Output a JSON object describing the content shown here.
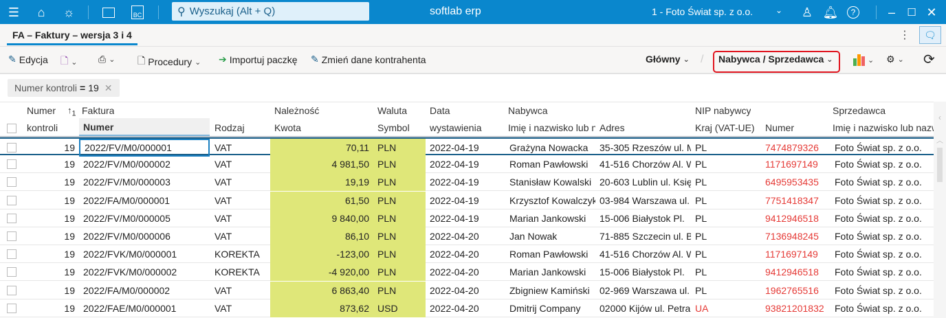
{
  "app": {
    "title": "softlab erp",
    "search_placeholder": "Wyszukaj (Alt + Q)",
    "company": "1 - Foto Świat sp. z o.o.",
    "icons": [
      "menu-icon",
      "home-icon",
      "bulb-icon",
      "news-icon",
      "bc-icon",
      "search-icon",
      "chevron-down-icon",
      "user-icon",
      "bell-icon",
      "help-icon",
      "minimize-icon",
      "maximize-icon",
      "close-icon"
    ]
  },
  "tab": {
    "label": "FA – Faktury – wersja 3 i 4"
  },
  "toolbar": {
    "edit": "Edycja",
    "procedures": "Procedury",
    "import": "Importuj paczkę",
    "change": "Zmień dane kontrahenta",
    "view_main": "Główny",
    "view_selected": "Nabywca / Sprzedawca"
  },
  "filter": {
    "label": "Numer kontroli",
    "op": "=",
    "value": "19"
  },
  "colors": {
    "accent": "#0a87cd",
    "highlight": "#dfe779",
    "nip": "#e53935"
  },
  "grid": {
    "groups": {
      "numer": "Numer",
      "faktura": "Faktura",
      "naleznosc": "Należność",
      "waluta": "Waluta",
      "data": "Data",
      "nabywca": "Nabywca",
      "nip": "NIP nabywcy",
      "sprzedawca": "Sprzedawca",
      "sort_order": "1"
    },
    "headers": {
      "kontroli": "kontroli",
      "numer": "Numer",
      "rodzaj": "Rodzaj",
      "kwota": "Kwota",
      "symbol": "Symbol",
      "wystawienia": "wystawienia",
      "imie": "Imię i nazwisko lub nazwa",
      "adres": "Adres",
      "kraj": "Kraj (VAT-UE)",
      "nip_numer": "Numer",
      "s_imie": "Imię i nazwisko lub nazwa"
    },
    "rows": [
      {
        "k": "19",
        "numer": "2022/FV/M0/000001",
        "rodzaj": "VAT",
        "kwota": "70,11",
        "sym": "PLN",
        "data": "2022-04-19",
        "imie": "Grażyna Nowacka",
        "adres": "35-305 Rzeszów ul. M",
        "kraj": "PL",
        "nip": "7474879326",
        "sprz": "Foto Świat sp. z o.o."
      },
      {
        "k": "19",
        "numer": "2022/FV/M0/000002",
        "rodzaj": "VAT",
        "kwota": "4 981,50",
        "sym": "PLN",
        "data": "2022-04-19",
        "imie": "Roman Pawłowski",
        "adres": "41-516 Chorzów Al. W",
        "kraj": "PL",
        "nip": "1171697149",
        "sprz": "Foto Świat sp. z o.o."
      },
      {
        "k": "19",
        "numer": "2022/FV/M0/000003",
        "rodzaj": "VAT",
        "kwota": "19,19",
        "sym": "PLN",
        "data": "2022-04-19",
        "imie": "Stanisław Kowalski",
        "adres": "20-603 Lublin ul. Księ",
        "kraj": "PL",
        "nip": "6495953435",
        "sprz": "Foto Świat sp. z o.o."
      },
      {
        "k": "19",
        "numer": "2022/FA/M0/000001",
        "rodzaj": "VAT",
        "kwota": "61,50",
        "sym": "PLN",
        "data": "2022-04-19",
        "imie": "Krzysztof Kowalczyk",
        "adres": "03-984 Warszawa ul.",
        "kraj": "PL",
        "nip": "7751418347",
        "sprz": "Foto Świat sp. z o.o."
      },
      {
        "k": "19",
        "numer": "2022/FV/M0/000005",
        "rodzaj": "VAT",
        "kwota": "9 840,00",
        "sym": "PLN",
        "data": "2022-04-19",
        "imie": "Marian Jankowski",
        "adres": "15-006 Białystok Pl.",
        "kraj": "PL",
        "nip": "9412946518",
        "sprz": "Foto Świat sp. z o.o."
      },
      {
        "k": "19",
        "numer": "2022/FV/M0/000006",
        "rodzaj": "VAT",
        "kwota": "86,10",
        "sym": "PLN",
        "data": "2022-04-20",
        "imie": "Jan Nowak",
        "adres": "71-885 Szczecin ul. B",
        "kraj": "PL",
        "nip": "7136948245",
        "sprz": "Foto Świat sp. z o.o."
      },
      {
        "k": "19",
        "numer": "2022/FVK/M0/000001",
        "rodzaj": "KOREKTA",
        "kwota": "-123,00",
        "sym": "PLN",
        "data": "2022-04-20",
        "imie": "Roman Pawłowski",
        "adres": "41-516 Chorzów Al. W",
        "kraj": "PL",
        "nip": "1171697149",
        "sprz": "Foto Świat sp. z o.o."
      },
      {
        "k": "19",
        "numer": "2022/FVK/M0/000002",
        "rodzaj": "KOREKTA",
        "kwota": "-4 920,00",
        "sym": "PLN",
        "data": "2022-04-20",
        "imie": "Marian Jankowski",
        "adres": "15-006 Białystok Pl.",
        "kraj": "PL",
        "nip": "9412946518",
        "sprz": "Foto Świat sp. z o.o."
      },
      {
        "k": "19",
        "numer": "2022/FA/M0/000002",
        "rodzaj": "VAT",
        "kwota": "6 863,40",
        "sym": "PLN",
        "data": "2022-04-20",
        "imie": "Zbigniew Kamiński",
        "adres": "02-969 Warszawa ul.",
        "kraj": "PL",
        "nip": "1962765516",
        "sprz": "Foto Świat sp. z o.o."
      },
      {
        "k": "19",
        "numer": "2022/FAE/M0/000001",
        "rodzaj": "VAT",
        "kwota": "873,62",
        "sym": "USD",
        "data": "2022-04-20",
        "imie": "Dmitrij Company",
        "adres": "02000 Kijów ul. Petra",
        "kraj": "UA",
        "nip": "93821201832",
        "sprz": "Foto Świat sp. z o.o."
      }
    ]
  }
}
